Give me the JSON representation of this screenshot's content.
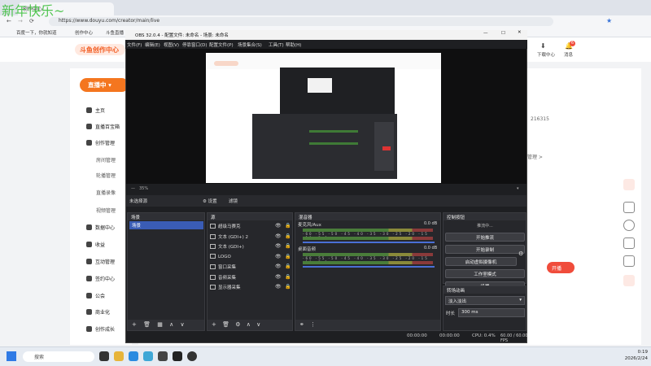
{
  "watermark": "新年快乐~",
  "browser": {
    "tab_title": "创作中心",
    "url": "https://www.douyu.com/creator/main/live",
    "bookmarks": [
      "百度一下，你就知道",
      "创作中心",
      "斗鱼直播"
    ],
    "download_label": "下载中心",
    "message_label": "消息",
    "message_badge": "6"
  },
  "site": {
    "logo": "斗鱼创作中心",
    "live_button": "直播中",
    "nav": [
      {
        "label": "主页",
        "sub": false
      },
      {
        "label": "直播百宝箱",
        "sub": false
      },
      {
        "label": "创作管理",
        "sub": false
      },
      {
        "label": "房间管理",
        "sub": true
      },
      {
        "label": "轮播管理",
        "sub": true
      },
      {
        "label": "直播录像",
        "sub": true
      },
      {
        "label": "视频管理",
        "sub": true
      },
      {
        "label": "数据中心",
        "sub": false
      },
      {
        "label": "收益",
        "sub": false
      },
      {
        "label": "互动管理",
        "sub": false
      },
      {
        "label": "签约中心",
        "sub": false
      },
      {
        "label": "公会",
        "sub": false
      },
      {
        "label": "商业化",
        "sub": false
      },
      {
        "label": "创作成长",
        "sub": false
      }
    ],
    "frag_id": "216315",
    "frag_text": "管理 >",
    "live_now": "开播"
  },
  "obs": {
    "title": "OBS 32.0.4 - 配置文件: 未命名 - 场景: 未命名",
    "menu": [
      "文件(F)",
      "编辑(E)",
      "视图(V)",
      "停靠窗口(D)",
      "配置文件(P)",
      "场景集合(S)",
      "工具(T)",
      "帮助(H)"
    ],
    "zoom": "35%",
    "no_source": "未选择源",
    "properties_btn": "⚙ 设置",
    "filters_btn": "滤镜",
    "scenes_title": "场景",
    "scene_item": "场景",
    "sources_title": "源",
    "sources": [
      {
        "name": "超级马赛克"
      },
      {
        "name": "文本 (GDI+) 2"
      },
      {
        "name": "文本 (GDI+)"
      },
      {
        "name": "LOGO"
      },
      {
        "name": "窗口采集"
      },
      {
        "name": "音频采集"
      },
      {
        "name": "显示器采集"
      }
    ],
    "mixer_title": "混音器",
    "mixer": [
      {
        "name": "麦克风/Aux",
        "db": "0.0 dB"
      },
      {
        "name": "桌面音频",
        "db": "0.0 dB"
      }
    ],
    "ticks": "-60 -55 -50 -45 -40 -35 -30 -25 -20 -15 -10 -5 0",
    "controls_title": "控制按钮",
    "controls": [
      "开始推流",
      "开始录制",
      "启动虚拟摄像机",
      "工作室模式",
      "设置"
    ],
    "streaming_status": "推流中...",
    "trans_title": "转场动画",
    "transition": "淡入淡出",
    "duration_label": "时长",
    "duration": "300 ms",
    "status_time1": "00:00:00",
    "status_time2": "00:00:00",
    "cpu": "CPU: 0.4%",
    "fps": "60.00 / 60.00 FPS"
  },
  "taskbar": {
    "search": "搜索",
    "time": "0:19",
    "date": "2026/2/24"
  }
}
